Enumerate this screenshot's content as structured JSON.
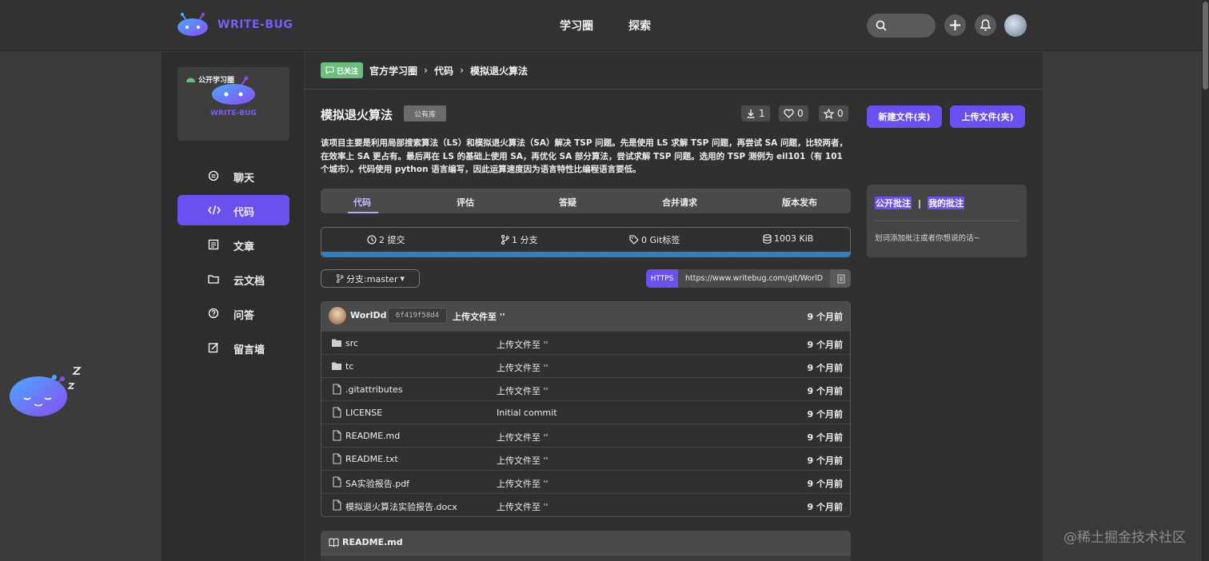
{
  "brand": {
    "name": "WRITE-BUG",
    "accent": "#6c4ff0"
  },
  "topnav": {
    "items": [
      {
        "label": "学习圈"
      },
      {
        "label": "探索"
      }
    ]
  },
  "sidebar": {
    "group_label": "公开学习圈",
    "group_brand": "WRITE-BUG",
    "items": [
      {
        "label": "聊天",
        "icon": "chat-icon"
      },
      {
        "label": "代码",
        "icon": "code-icon",
        "active": true
      },
      {
        "label": "文章",
        "icon": "article-icon"
      },
      {
        "label": "云文档",
        "icon": "folder-icon"
      },
      {
        "label": "问答",
        "icon": "question-icon"
      },
      {
        "label": "留言墙",
        "icon": "edit-icon"
      }
    ]
  },
  "breadcrumb": {
    "badge": "已关注",
    "items": [
      "官方学习圈",
      "代码",
      "模拟退火算法"
    ]
  },
  "repo": {
    "title": "模拟退火算法",
    "visibility": "公有库",
    "downloads": "1",
    "likes": "0",
    "stars": "0",
    "new_button": "新建文件(夹)",
    "upload_button": "上传文件(夹)",
    "description": "该项目主要是利用局部搜索算法（LS）和模拟退火算法（SA）解决 TSP 问题。先是使用 LS 求解 TSP 问题，再尝试 SA 问题，比较两者，在效率上 SA 更占有。最后再在 LS 的基础上使用 SA，再优化 SA 部分算法，尝试求解 TSP 问题。选用的 TSP 测例为 eil101（有 101 个城市）。代码使用 python 语言编写，因此运算速度因为语言特性比编程语言要低。"
  },
  "tabs": [
    "代码",
    "评估",
    "答疑",
    "合并请求",
    "版本发布"
  ],
  "stats": {
    "commits": "2 提交",
    "branches": "1 分支",
    "tags": "0 Git标签",
    "size": "1003 KiB"
  },
  "branch": {
    "label": "分支:master"
  },
  "clone": {
    "protocol": "HTTPS",
    "url": "https://www.writebug.com/git/WorlD"
  },
  "latest_commit": {
    "user": "WorlDd",
    "hash": "6f419f58d4",
    "message": "上传文件至 ''",
    "time": "9 个月前"
  },
  "files": [
    {
      "name": "src",
      "type": "folder",
      "message": "上传文件至 ''",
      "time": "9 个月前"
    },
    {
      "name": "tc",
      "type": "folder",
      "message": "上传文件至 ''",
      "time": "9 个月前"
    },
    {
      "name": ".gitattributes",
      "type": "file",
      "message": "上传文件至 ''",
      "time": "9 个月前"
    },
    {
      "name": "LICENSE",
      "type": "file",
      "message": "Initial commit",
      "time": "9 个月前"
    },
    {
      "name": "README.md",
      "type": "file",
      "message": "上传文件至 ''",
      "time": "9 个月前"
    },
    {
      "name": "README.txt",
      "type": "file",
      "message": "上传文件至 ''",
      "time": "9 个月前"
    },
    {
      "name": "SA实验报告.pdf",
      "type": "file",
      "message": "上传文件至 ''",
      "time": "9 个月前"
    },
    {
      "name": "模拟退火算法实验报告.docx",
      "type": "file",
      "message": "上传文件至 ''",
      "time": "9 个月前"
    }
  ],
  "readme": {
    "title": "README.md"
  },
  "notes": {
    "tab_public": "公开批注",
    "separator": "|",
    "tab_mine": "我的批注",
    "hint": "划词添加批注或者你想说的话~"
  },
  "watermark": "@稀土掘金技术社区"
}
